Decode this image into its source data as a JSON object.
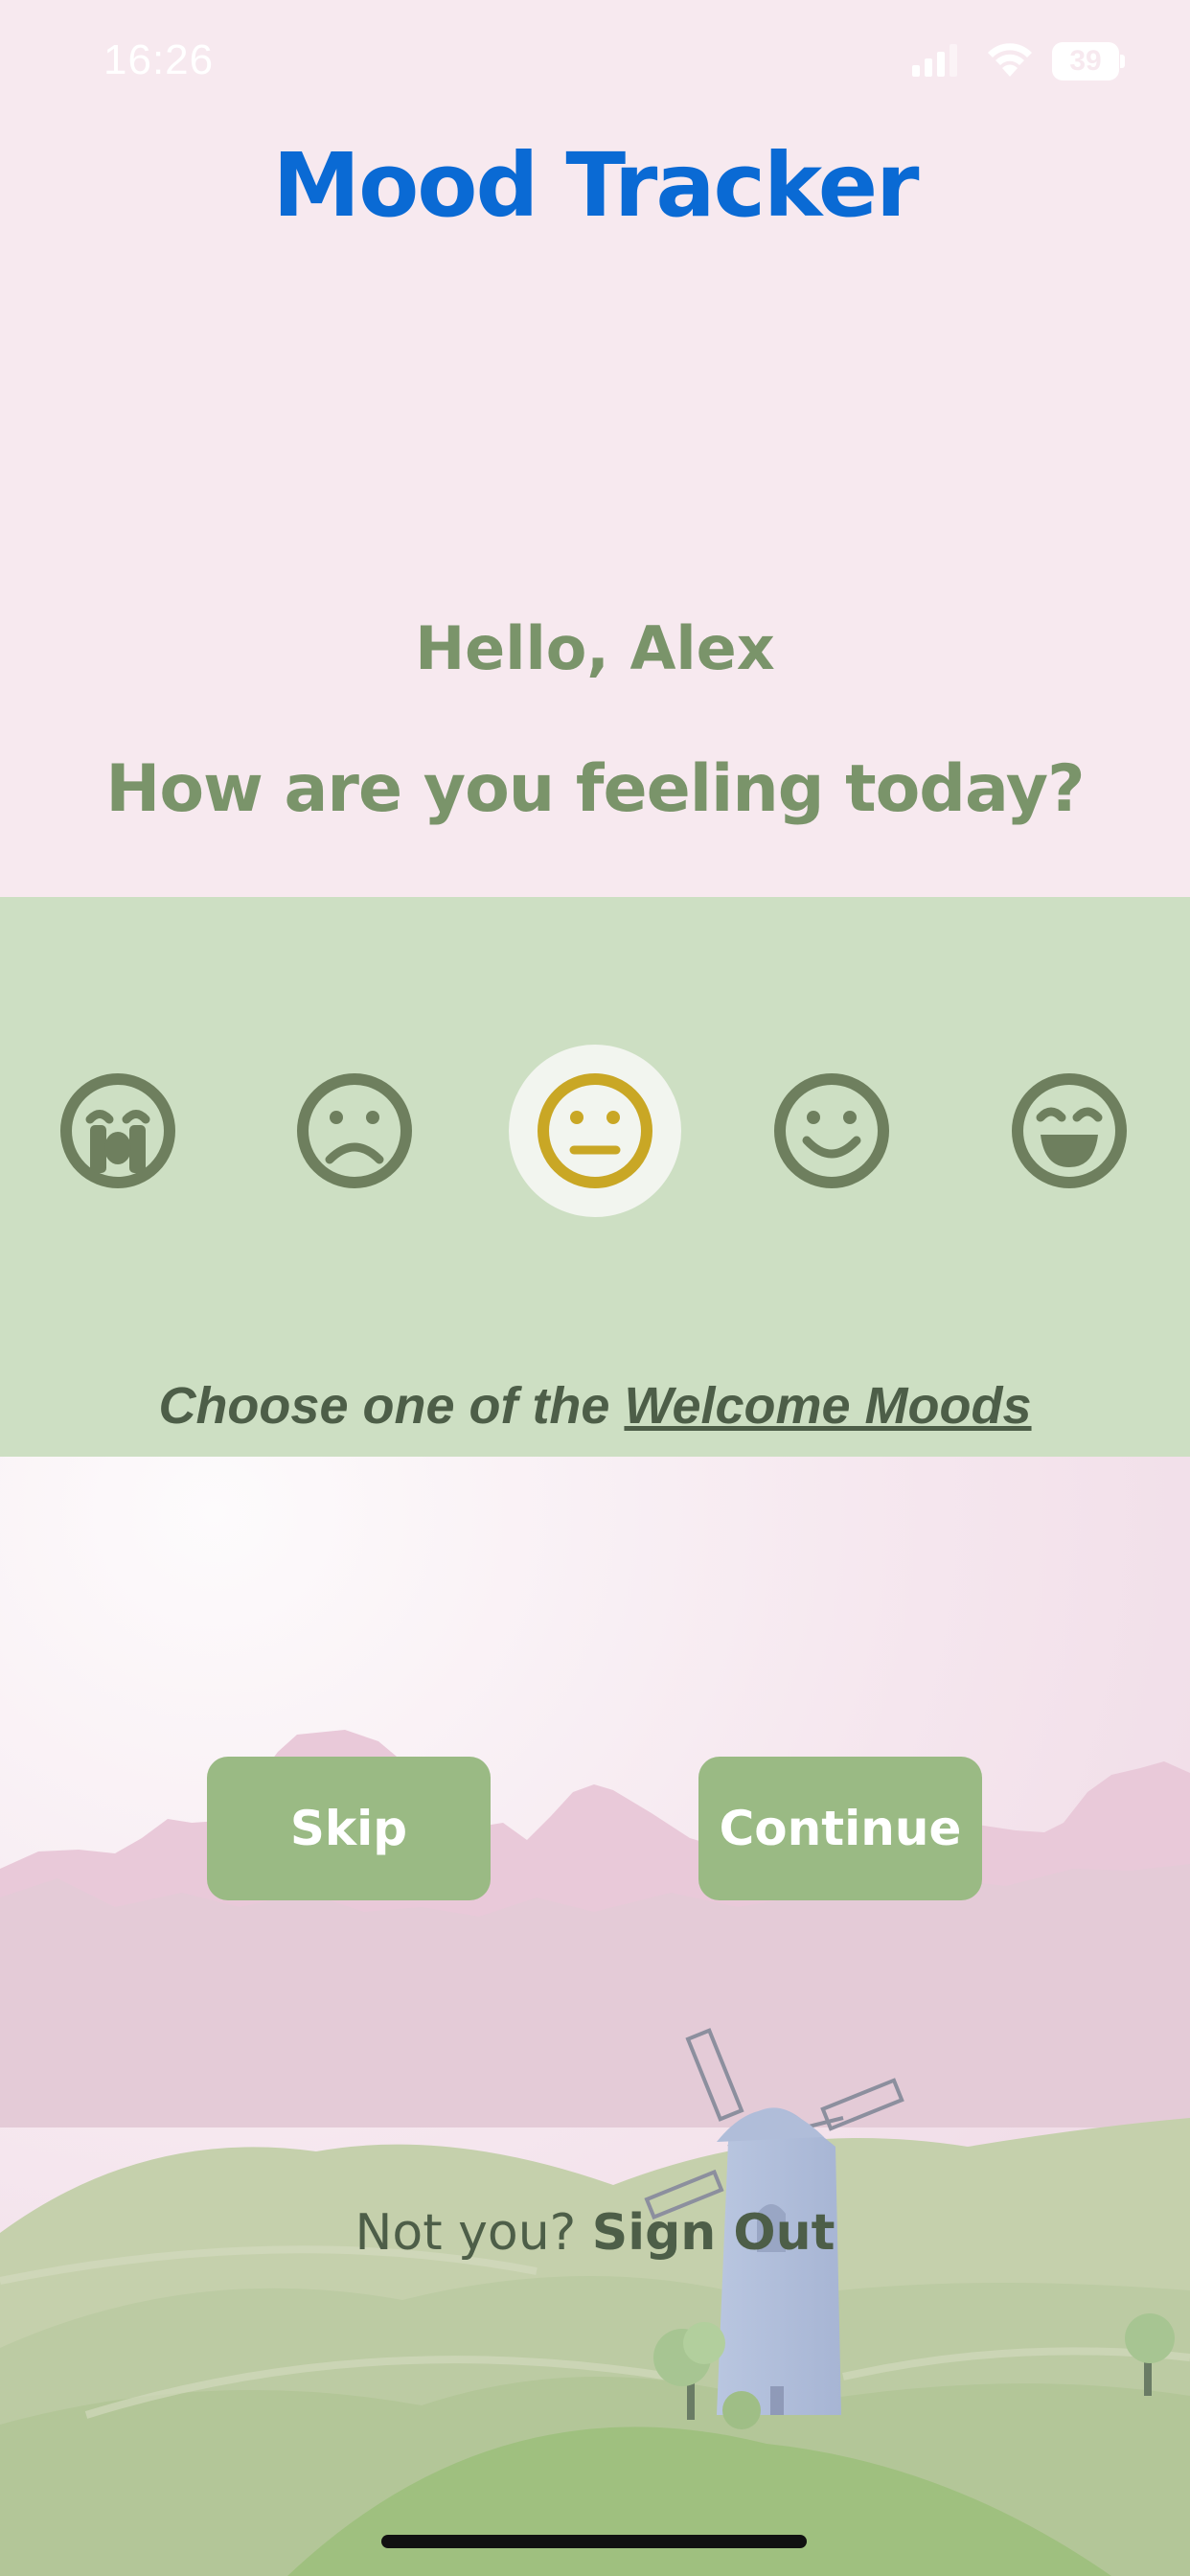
{
  "status_bar": {
    "time": "16:26",
    "battery": "39",
    "icons": [
      "signal-icon",
      "wifi-icon",
      "battery-icon"
    ]
  },
  "app": {
    "title": "Mood Tracker"
  },
  "greeting": {
    "hello": "Hello, Alex",
    "question": "How are you feeling today?"
  },
  "moods": {
    "options": [
      {
        "icon": "crying-face-icon",
        "selected": false
      },
      {
        "icon": "sad-face-icon",
        "selected": false
      },
      {
        "icon": "neutral-face-icon",
        "selected": true
      },
      {
        "icon": "smile-face-icon",
        "selected": false
      },
      {
        "icon": "grin-face-icon",
        "selected": false
      }
    ],
    "prompt_prefix": "Choose one of the ",
    "prompt_link": "Welcome Moods"
  },
  "actions": {
    "skip_label": "Skip",
    "continue_label": "Continue"
  },
  "footer": {
    "not_you": "Not you?",
    "sign_out": "Sign Out"
  },
  "colors": {
    "background": "#f7e9ef",
    "title": "#0a6ad4",
    "greeting_text": "#7a946a",
    "mood_band": "#cddfc3",
    "mood_icon": "#6e7f5e",
    "selected_mood_icon": "#c9a725",
    "button": "#9aba84"
  }
}
